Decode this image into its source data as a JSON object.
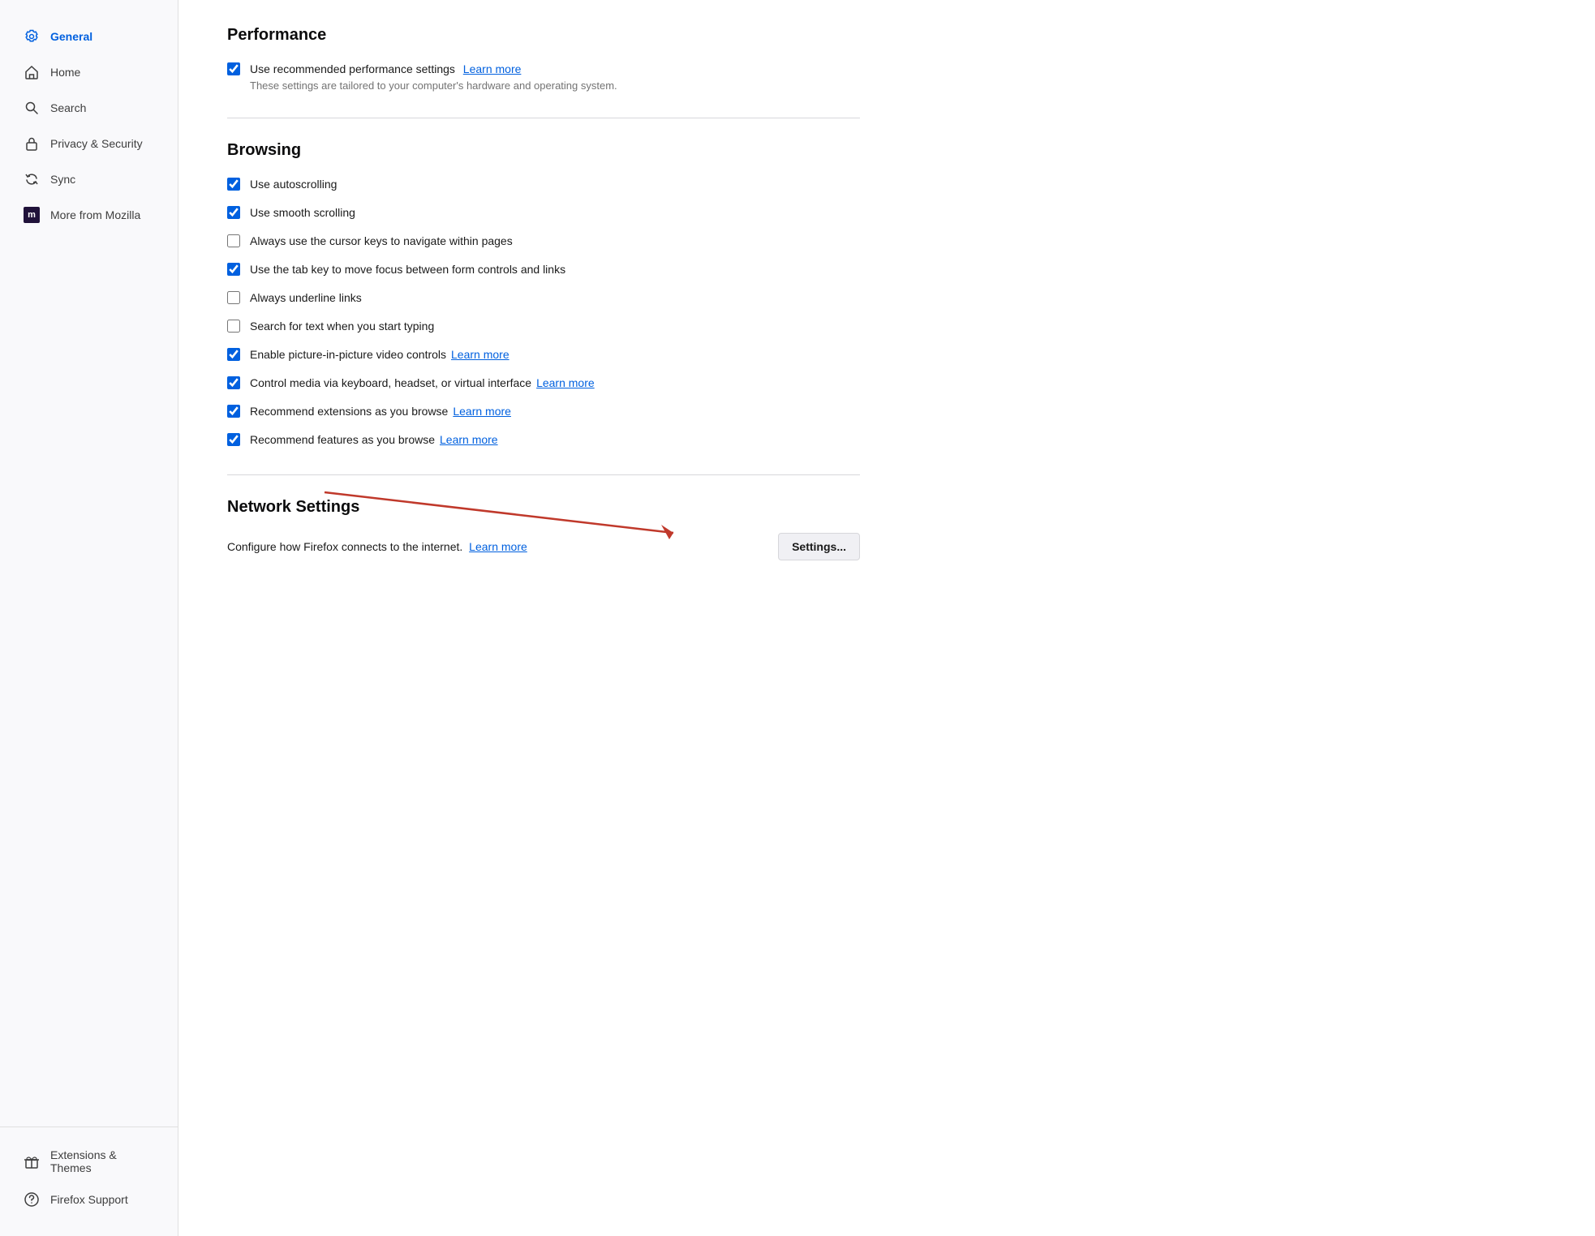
{
  "sidebar": {
    "items": [
      {
        "id": "general",
        "label": "General",
        "icon": "gear",
        "active": true
      },
      {
        "id": "home",
        "label": "Home",
        "icon": "home",
        "active": false
      },
      {
        "id": "search",
        "label": "Search",
        "icon": "search",
        "active": false
      },
      {
        "id": "privacy",
        "label": "Privacy & Security",
        "icon": "lock",
        "active": false
      },
      {
        "id": "sync",
        "label": "Sync",
        "icon": "sync",
        "active": false
      },
      {
        "id": "mozilla",
        "label": "More from Mozilla",
        "icon": "mozilla",
        "active": false
      }
    ],
    "bottom_items": [
      {
        "id": "extensions",
        "label": "Extensions & Themes",
        "icon": "gift"
      },
      {
        "id": "support",
        "label": "Firefox Support",
        "icon": "help"
      }
    ]
  },
  "performance": {
    "title": "Performance",
    "recommended_label": "Use recommended performance settings",
    "recommended_checked": true,
    "recommended_learn_more": "Learn more",
    "recommended_sublabel": "These settings are tailored to your computer's hardware and operating system."
  },
  "browsing": {
    "title": "Browsing",
    "options": [
      {
        "id": "autoscroll",
        "label": "Use autoscrolling",
        "checked": true,
        "learn_more": null
      },
      {
        "id": "smooth_scroll",
        "label": "Use smooth scrolling",
        "checked": true,
        "learn_more": null
      },
      {
        "id": "cursor_keys",
        "label": "Always use the cursor keys to navigate within pages",
        "checked": false,
        "learn_more": null
      },
      {
        "id": "tab_key",
        "label": "Use the tab key to move focus between form controls and links",
        "checked": true,
        "learn_more": null
      },
      {
        "id": "underline",
        "label": "Always underline links",
        "checked": false,
        "learn_more": null
      },
      {
        "id": "search_typing",
        "label": "Search for text when you start typing",
        "checked": false,
        "learn_more": null
      },
      {
        "id": "pip",
        "label": "Enable picture-in-picture video controls",
        "checked": true,
        "learn_more": "Learn more"
      },
      {
        "id": "media_keys",
        "label": "Control media via keyboard, headset, or virtual interface",
        "checked": true,
        "learn_more": "Learn more"
      },
      {
        "id": "recommend_ext",
        "label": "Recommend extensions as you browse",
        "checked": true,
        "learn_more": "Learn more"
      },
      {
        "id": "recommend_feat",
        "label": "Recommend features as you browse",
        "checked": true,
        "learn_more": "Learn more"
      }
    ]
  },
  "network": {
    "title": "Network Settings",
    "description": "Configure how Firefox connects to the internet.",
    "learn_more": "Learn more",
    "settings_button": "Settings..."
  }
}
